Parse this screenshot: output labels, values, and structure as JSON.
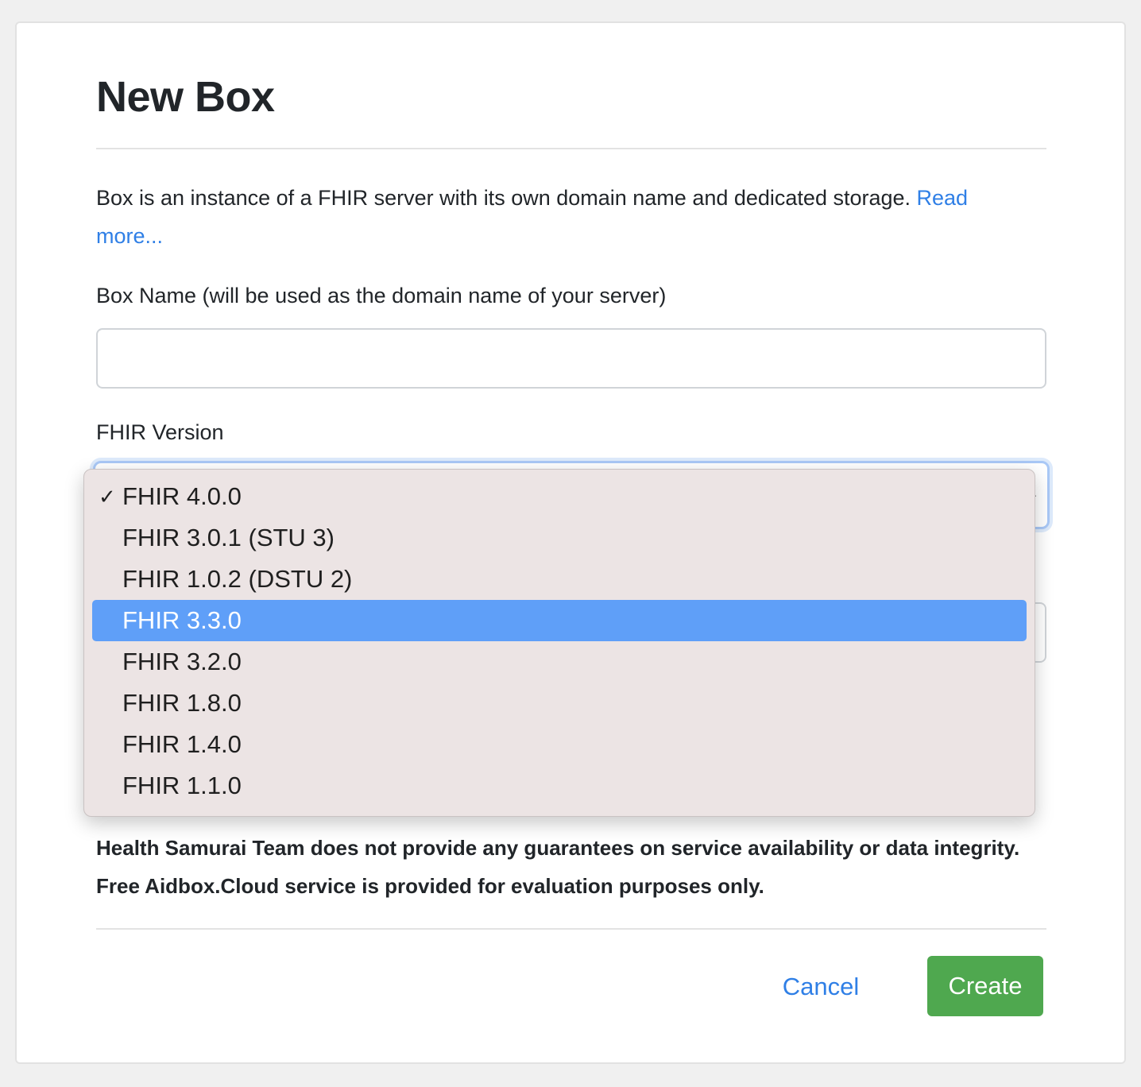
{
  "dialog": {
    "title": "New Box",
    "description": "Box is an instance of a FHIR server with its own domain name and dedicated storage. ",
    "read_more_link": "Read more...",
    "box_name_label": "Box Name (will be used as the domain name of your server)",
    "box_name_value": "",
    "fhir_version_label": "FHIR Version",
    "fhir_version_selected": "FHIR 4.0.0",
    "fhir_version_options": [
      "FHIR 4.0.0",
      "FHIR 3.0.1 (STU 3)",
      "FHIR 1.0.2 (DSTU 2)",
      "FHIR 3.3.0",
      "FHIR 3.2.0",
      "FHIR 1.8.0",
      "FHIR 1.4.0",
      "FHIR 1.1.0"
    ],
    "highlighted_option": "FHIR 3.3.0",
    "warning_line1": "Health Samurai Team does not provide any guarantees on service availability or data integrity.",
    "warning_line2": "Free Aidbox.Cloud service is provided for evaluation purposes only.",
    "cancel_label": "Cancel",
    "create_label": "Create"
  },
  "icons": {
    "check": "checkmark-icon",
    "select_arrow": "chevron-down-icon"
  },
  "colors": {
    "link": "#2f7fe6",
    "primary_button": "#4fa84f",
    "highlight": "#5f9ff8",
    "dropdown_bg": "#ece4e4"
  }
}
